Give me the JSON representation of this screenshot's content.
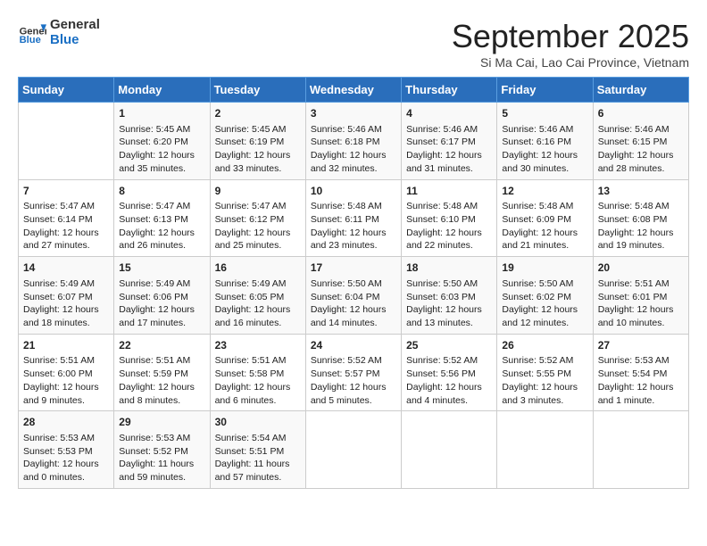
{
  "logo": {
    "line1": "General",
    "line2": "Blue"
  },
  "title": "September 2025",
  "subtitle": "Si Ma Cai, Lao Cai Province, Vietnam",
  "days_of_week": [
    "Sunday",
    "Monday",
    "Tuesday",
    "Wednesday",
    "Thursday",
    "Friday",
    "Saturday"
  ],
  "weeks": [
    [
      {
        "day": "",
        "content": ""
      },
      {
        "day": "1",
        "content": "Sunrise: 5:45 AM\nSunset: 6:20 PM\nDaylight: 12 hours\nand 35 minutes."
      },
      {
        "day": "2",
        "content": "Sunrise: 5:45 AM\nSunset: 6:19 PM\nDaylight: 12 hours\nand 33 minutes."
      },
      {
        "day": "3",
        "content": "Sunrise: 5:46 AM\nSunset: 6:18 PM\nDaylight: 12 hours\nand 32 minutes."
      },
      {
        "day": "4",
        "content": "Sunrise: 5:46 AM\nSunset: 6:17 PM\nDaylight: 12 hours\nand 31 minutes."
      },
      {
        "day": "5",
        "content": "Sunrise: 5:46 AM\nSunset: 6:16 PM\nDaylight: 12 hours\nand 30 minutes."
      },
      {
        "day": "6",
        "content": "Sunrise: 5:46 AM\nSunset: 6:15 PM\nDaylight: 12 hours\nand 28 minutes."
      }
    ],
    [
      {
        "day": "7",
        "content": "Sunrise: 5:47 AM\nSunset: 6:14 PM\nDaylight: 12 hours\nand 27 minutes."
      },
      {
        "day": "8",
        "content": "Sunrise: 5:47 AM\nSunset: 6:13 PM\nDaylight: 12 hours\nand 26 minutes."
      },
      {
        "day": "9",
        "content": "Sunrise: 5:47 AM\nSunset: 6:12 PM\nDaylight: 12 hours\nand 25 minutes."
      },
      {
        "day": "10",
        "content": "Sunrise: 5:48 AM\nSunset: 6:11 PM\nDaylight: 12 hours\nand 23 minutes."
      },
      {
        "day": "11",
        "content": "Sunrise: 5:48 AM\nSunset: 6:10 PM\nDaylight: 12 hours\nand 22 minutes."
      },
      {
        "day": "12",
        "content": "Sunrise: 5:48 AM\nSunset: 6:09 PM\nDaylight: 12 hours\nand 21 minutes."
      },
      {
        "day": "13",
        "content": "Sunrise: 5:48 AM\nSunset: 6:08 PM\nDaylight: 12 hours\nand 19 minutes."
      }
    ],
    [
      {
        "day": "14",
        "content": "Sunrise: 5:49 AM\nSunset: 6:07 PM\nDaylight: 12 hours\nand 18 minutes."
      },
      {
        "day": "15",
        "content": "Sunrise: 5:49 AM\nSunset: 6:06 PM\nDaylight: 12 hours\nand 17 minutes."
      },
      {
        "day": "16",
        "content": "Sunrise: 5:49 AM\nSunset: 6:05 PM\nDaylight: 12 hours\nand 16 minutes."
      },
      {
        "day": "17",
        "content": "Sunrise: 5:50 AM\nSunset: 6:04 PM\nDaylight: 12 hours\nand 14 minutes."
      },
      {
        "day": "18",
        "content": "Sunrise: 5:50 AM\nSunset: 6:03 PM\nDaylight: 12 hours\nand 13 minutes."
      },
      {
        "day": "19",
        "content": "Sunrise: 5:50 AM\nSunset: 6:02 PM\nDaylight: 12 hours\nand 12 minutes."
      },
      {
        "day": "20",
        "content": "Sunrise: 5:51 AM\nSunset: 6:01 PM\nDaylight: 12 hours\nand 10 minutes."
      }
    ],
    [
      {
        "day": "21",
        "content": "Sunrise: 5:51 AM\nSunset: 6:00 PM\nDaylight: 12 hours\nand 9 minutes."
      },
      {
        "day": "22",
        "content": "Sunrise: 5:51 AM\nSunset: 5:59 PM\nDaylight: 12 hours\nand 8 minutes."
      },
      {
        "day": "23",
        "content": "Sunrise: 5:51 AM\nSunset: 5:58 PM\nDaylight: 12 hours\nand 6 minutes."
      },
      {
        "day": "24",
        "content": "Sunrise: 5:52 AM\nSunset: 5:57 PM\nDaylight: 12 hours\nand 5 minutes."
      },
      {
        "day": "25",
        "content": "Sunrise: 5:52 AM\nSunset: 5:56 PM\nDaylight: 12 hours\nand 4 minutes."
      },
      {
        "day": "26",
        "content": "Sunrise: 5:52 AM\nSunset: 5:55 PM\nDaylight: 12 hours\nand 3 minutes."
      },
      {
        "day": "27",
        "content": "Sunrise: 5:53 AM\nSunset: 5:54 PM\nDaylight: 12 hours\nand 1 minute."
      }
    ],
    [
      {
        "day": "28",
        "content": "Sunrise: 5:53 AM\nSunset: 5:53 PM\nDaylight: 12 hours\nand 0 minutes."
      },
      {
        "day": "29",
        "content": "Sunrise: 5:53 AM\nSunset: 5:52 PM\nDaylight: 11 hours\nand 59 minutes."
      },
      {
        "day": "30",
        "content": "Sunrise: 5:54 AM\nSunset: 5:51 PM\nDaylight: 11 hours\nand 57 minutes."
      },
      {
        "day": "",
        "content": ""
      },
      {
        "day": "",
        "content": ""
      },
      {
        "day": "",
        "content": ""
      },
      {
        "day": "",
        "content": ""
      }
    ]
  ]
}
